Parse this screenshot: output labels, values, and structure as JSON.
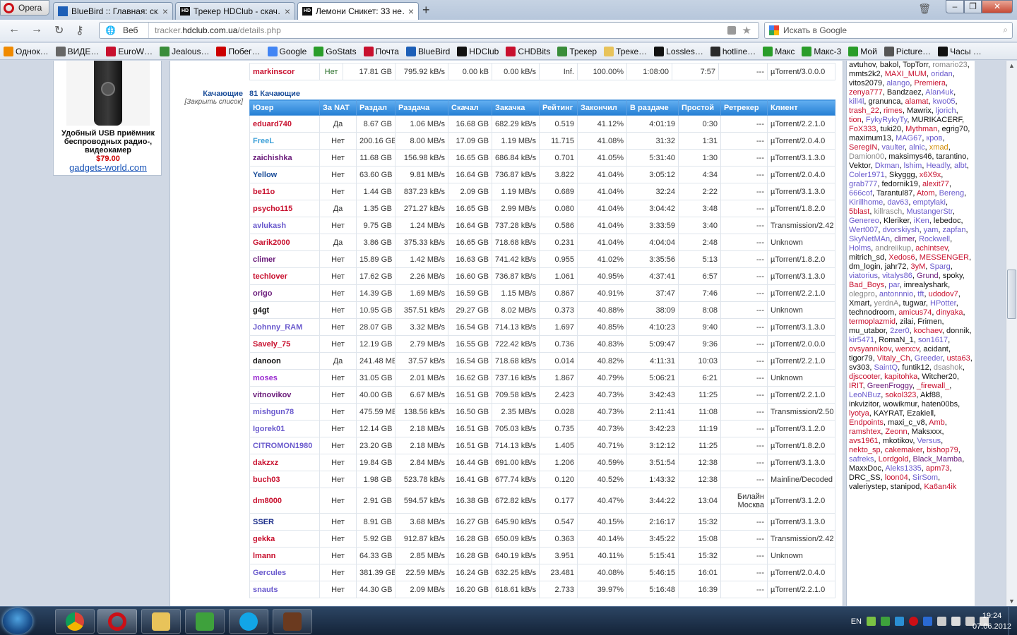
{
  "browser": {
    "menu_label": "Opera",
    "tabs": [
      {
        "title": "BlueBird :: Главная: ск…",
        "icon": "bluebird-favicon"
      },
      {
        "title": "Трекер HDClub - скач…",
        "icon": "hdclub-favicon"
      },
      {
        "title": "Лемони Сникет: 33 не…",
        "icon": "hdclub-favicon",
        "active": true
      }
    ],
    "new_tab": "+",
    "mode_label": "Веб",
    "url_prefix": "tracker.",
    "url_host": "hdclub.com.ua",
    "url_path": "/details.php",
    "search_placeholder": "Искать в Google",
    "bookmarks": [
      "Однок…",
      "ВИДЕ…",
      "EuroW…",
      "Jealous…",
      "Побег…",
      "Google",
      "GoStats",
      "Почта",
      "BlueBird",
      "HDClub",
      "CHDBits",
      "Трекер",
      "Треке…",
      "Lossles…",
      "hotline…",
      "Макс",
      "Макс-3",
      "Мой",
      "Picture…",
      "Часы …"
    ]
  },
  "ad": {
    "text": "Удобный USB приёмник беспроводных радио-, видеокамер",
    "price": "$79.00",
    "url": "gadgets-world.com"
  },
  "top_row": [
    "markinscor",
    "Нет",
    "17.81 GB",
    "795.92 kB/s",
    "0.00 kB",
    "0.00 kB/s",
    "Inf.",
    "100.00%",
    "1:08:00",
    "7:57",
    "---",
    "µTorrent/3.0.0.0"
  ],
  "section": {
    "title": "Качающие",
    "close_link": "[Закрыть список]",
    "count": "81 Качающие"
  },
  "headers": [
    "Юзер",
    "За NAT",
    "Раздал",
    "Раздача",
    "Скачал",
    "Закачка",
    "Рейтинг",
    "Закончил",
    "В раздаче",
    "Простой",
    "Ретрекер",
    "Клиент"
  ],
  "peers": [
    {
      "user": "eduard740",
      "color": "#c8102e",
      "nat": "Да",
      "up": "8.67 GB",
      "ups": "1.06 MB/s",
      "down": "16.68 GB",
      "downs": "682.29 kB/s",
      "ratio": "0.519",
      "done": "41.12%",
      "seed": "4:01:19",
      "idle": "0:30",
      "retr": "---",
      "client": "µTorrent/2.2.1.0"
    },
    {
      "user": "FreeL",
      "color": "#3da0d8",
      "nat": "Нет",
      "up": "200.16 GB",
      "ups": "8.00 MB/s",
      "down": "17.09 GB",
      "downs": "1.19 MB/s",
      "ratio": "11.715",
      "done": "41.08%",
      "seed": "31:32",
      "idle": "1:31",
      "retr": "---",
      "client": "µTorrent/2.0.4.0"
    },
    {
      "user": "zaichishka",
      "color": "#6a1b7a",
      "nat": "Нет",
      "up": "11.68 GB",
      "ups": "156.98 kB/s",
      "down": "16.65 GB",
      "downs": "686.84 kB/s",
      "ratio": "0.701",
      "done": "41.05%",
      "seed": "5:31:40",
      "idle": "1:30",
      "retr": "---",
      "client": "µTorrent/3.1.3.0"
    },
    {
      "user": "Yellow",
      "color": "#1d4f9a",
      "nat": "Нет",
      "up": "63.60 GB",
      "ups": "9.81 MB/s",
      "down": "16.64 GB",
      "downs": "736.87 kB/s",
      "ratio": "3.822",
      "done": "41.04%",
      "seed": "3:05:12",
      "idle": "4:34",
      "retr": "---",
      "client": "µTorrent/2.0.4.0"
    },
    {
      "user": "be11o",
      "color": "#c8102e",
      "nat": "Нет",
      "up": "1.44 GB",
      "ups": "837.23 kB/s",
      "down": "2.09 GB",
      "downs": "1.19 MB/s",
      "ratio": "0.689",
      "done": "41.04%",
      "seed": "32:24",
      "idle": "2:22",
      "retr": "---",
      "client": "µTorrent/3.1.3.0"
    },
    {
      "user": "psycho115",
      "color": "#c8102e",
      "nat": "Да",
      "up": "1.35 GB",
      "ups": "271.27 kB/s",
      "down": "16.65 GB",
      "downs": "2.99 MB/s",
      "ratio": "0.080",
      "done": "41.04%",
      "seed": "3:04:42",
      "idle": "3:48",
      "retr": "---",
      "client": "µTorrent/1.8.2.0"
    },
    {
      "user": "avlukash",
      "color": "#6a5acd",
      "nat": "Нет",
      "up": "9.75 GB",
      "ups": "1.24 MB/s",
      "down": "16.64 GB",
      "downs": "737.28 kB/s",
      "ratio": "0.586",
      "done": "41.04%",
      "seed": "3:33:59",
      "idle": "3:40",
      "retr": "---",
      "client": "Transmission/2.42"
    },
    {
      "user": "Garik2000",
      "color": "#c8102e",
      "nat": "Да",
      "up": "3.86 GB",
      "ups": "375.33 kB/s",
      "down": "16.65 GB",
      "downs": "718.68 kB/s",
      "ratio": "0.231",
      "done": "41.04%",
      "seed": "4:04:04",
      "idle": "2:48",
      "retr": "---",
      "client": "Unknown"
    },
    {
      "user": "climer",
      "color": "#6a1b7a",
      "nat": "Нет",
      "up": "15.89 GB",
      "ups": "1.42 MB/s",
      "down": "16.63 GB",
      "downs": "741.42 kB/s",
      "ratio": "0.955",
      "done": "41.02%",
      "seed": "3:35:56",
      "idle": "5:13",
      "retr": "---",
      "client": "µTorrent/1.8.2.0"
    },
    {
      "user": "techlover",
      "color": "#c8102e",
      "nat": "Нет",
      "up": "17.62 GB",
      "ups": "2.26 MB/s",
      "down": "16.60 GB",
      "downs": "736.87 kB/s",
      "ratio": "1.061",
      "done": "40.95%",
      "seed": "4:37:41",
      "idle": "6:57",
      "retr": "---",
      "client": "µTorrent/3.1.3.0"
    },
    {
      "user": "origo",
      "color": "#6a1b7a",
      "nat": "Нет",
      "up": "14.39 GB",
      "ups": "1.69 MB/s",
      "down": "16.59 GB",
      "downs": "1.15 MB/s",
      "ratio": "0.867",
      "done": "40.91%",
      "seed": "37:47",
      "idle": "7:46",
      "retr": "---",
      "client": "µTorrent/2.2.1.0"
    },
    {
      "user": "g4gt",
      "color": "#111111",
      "nat": "Нет",
      "up": "10.95 GB",
      "ups": "357.51 kB/s",
      "down": "29.27 GB",
      "downs": "8.02 MB/s",
      "ratio": "0.373",
      "done": "40.88%",
      "seed": "38:09",
      "idle": "8:08",
      "retr": "---",
      "client": "Unknown"
    },
    {
      "user": "Johnny_RAM",
      "color": "#6a5acd",
      "nat": "Нет",
      "up": "28.07 GB",
      "ups": "3.32 MB/s",
      "down": "16.54 GB",
      "downs": "714.13 kB/s",
      "ratio": "1.697",
      "done": "40.85%",
      "seed": "4:10:23",
      "idle": "9:40",
      "retr": "---",
      "client": "µTorrent/3.1.3.0"
    },
    {
      "user": "Savely_75",
      "color": "#c8102e",
      "nat": "Нет",
      "up": "12.19 GB",
      "ups": "2.79 MB/s",
      "down": "16.55 GB",
      "downs": "722.42 kB/s",
      "ratio": "0.736",
      "done": "40.83%",
      "seed": "5:09:47",
      "idle": "9:36",
      "retr": "---",
      "client": "µTorrent/2.0.0.0"
    },
    {
      "user": "danoon",
      "color": "#111111",
      "nat": "Да",
      "up": "241.48 MB",
      "ups": "37.57 kB/s",
      "down": "16.54 GB",
      "downs": "718.68 kB/s",
      "ratio": "0.014",
      "done": "40.82%",
      "seed": "4:11:31",
      "idle": "10:03",
      "retr": "---",
      "client": "µTorrent/2.2.1.0"
    },
    {
      "user": "moses",
      "color": "#9a2bd0",
      "nat": "Нет",
      "up": "31.05 GB",
      "ups": "2.01 MB/s",
      "down": "16.62 GB",
      "downs": "737.16 kB/s",
      "ratio": "1.867",
      "done": "40.79%",
      "seed": "5:06:21",
      "idle": "6:21",
      "retr": "---",
      "client": "Unknown"
    },
    {
      "user": "vitnovikov",
      "color": "#6a1b7a",
      "nat": "Нет",
      "up": "40.00 GB",
      "ups": "6.67 MB/s",
      "down": "16.51 GB",
      "downs": "709.58 kB/s",
      "ratio": "2.423",
      "done": "40.73%",
      "seed": "3:42:43",
      "idle": "11:25",
      "retr": "---",
      "client": "µTorrent/2.2.1.0"
    },
    {
      "user": "mishgun78",
      "color": "#6a5acd",
      "nat": "Нет",
      "up": "475.59 MB",
      "ups": "138.56 kB/s",
      "down": "16.50 GB",
      "downs": "2.35 MB/s",
      "ratio": "0.028",
      "done": "40.73%",
      "seed": "2:11:41",
      "idle": "11:08",
      "retr": "---",
      "client": "Transmission/2.50"
    },
    {
      "user": "Igorek01",
      "color": "#6a5acd",
      "nat": "Нет",
      "up": "12.14 GB",
      "ups": "2.18 MB/s",
      "down": "16.51 GB",
      "downs": "705.03 kB/s",
      "ratio": "0.735",
      "done": "40.73%",
      "seed": "3:42:23",
      "idle": "11:19",
      "retr": "---",
      "client": "µTorrent/3.1.2.0"
    },
    {
      "user": "CITROMON1980",
      "color": "#6a5acd",
      "nat": "Нет",
      "up": "23.20 GB",
      "ups": "2.18 MB/s",
      "down": "16.51 GB",
      "downs": "714.13 kB/s",
      "ratio": "1.405",
      "done": "40.71%",
      "seed": "3:12:12",
      "idle": "11:25",
      "retr": "---",
      "client": "µTorrent/1.8.2.0"
    },
    {
      "user": "dakzxz",
      "color": "#c8102e",
      "nat": "Нет",
      "up": "19.84 GB",
      "ups": "2.84 MB/s",
      "down": "16.44 GB",
      "downs": "691.00 kB/s",
      "ratio": "1.206",
      "done": "40.59%",
      "seed": "3:51:54",
      "idle": "12:38",
      "retr": "---",
      "client": "µTorrent/3.1.3.0"
    },
    {
      "user": "buch03",
      "color": "#c8102e",
      "nat": "Нет",
      "up": "1.98 GB",
      "ups": "523.78 kB/s",
      "down": "16.41 GB",
      "downs": "677.74 kB/s",
      "ratio": "0.120",
      "done": "40.52%",
      "seed": "1:43:32",
      "idle": "12:38",
      "retr": "---",
      "client": "Mainline/Decoded"
    },
    {
      "user": "dm8000",
      "color": "#c8102e",
      "nat": "Нет",
      "up": "2.91 GB",
      "ups": "594.57 kB/s",
      "down": "16.38 GB",
      "downs": "672.82 kB/s",
      "ratio": "0.177",
      "done": "40.47%",
      "seed": "3:44:22",
      "idle": "13:04",
      "retr": "Билайн Москва",
      "client": "µTorrent/3.1.2.0"
    },
    {
      "user": "SSER",
      "color": "#1d2f8a",
      "nat": "Нет",
      "up": "8.91 GB",
      "ups": "3.68 MB/s",
      "down": "16.27 GB",
      "downs": "645.90 kB/s",
      "ratio": "0.547",
      "done": "40.15%",
      "seed": "2:16:17",
      "idle": "15:32",
      "retr": "---",
      "client": "µTorrent/3.1.3.0"
    },
    {
      "user": "gekka",
      "color": "#c8102e",
      "nat": "Нет",
      "up": "5.92 GB",
      "ups": "912.87 kB/s",
      "down": "16.28 GB",
      "downs": "650.09 kB/s",
      "ratio": "0.363",
      "done": "40.14%",
      "seed": "3:45:22",
      "idle": "15:08",
      "retr": "---",
      "client": "Transmission/2.42"
    },
    {
      "user": "lmann",
      "color": "#c8102e",
      "nat": "Нет",
      "up": "64.33 GB",
      "ups": "2.85 MB/s",
      "down": "16.28 GB",
      "downs": "640.19 kB/s",
      "ratio": "3.951",
      "done": "40.11%",
      "seed": "5:15:41",
      "idle": "15:32",
      "retr": "---",
      "client": "Unknown"
    },
    {
      "user": "Gercules",
      "color": "#6a5acd",
      "nat": "Нет",
      "up": "381.39 GB",
      "ups": "22.59 MB/s",
      "down": "16.24 GB",
      "downs": "632.25 kB/s",
      "ratio": "23.481",
      "done": "40.08%",
      "seed": "5:46:15",
      "idle": "16:01",
      "retr": "---",
      "client": "µTorrent/2.0.4.0"
    },
    {
      "user": "snauts",
      "color": "#6a5acd",
      "nat": "Нет",
      "up": "44.30 GB",
      "ups": "2.09 MB/s",
      "down": "16.20 GB",
      "downs": "618.61 kB/s",
      "ratio": "2.733",
      "done": "39.97%",
      "seed": "5:16:48",
      "idle": "16:39",
      "retr": "---",
      "client": "µTorrent/2.2.1.0"
    }
  ],
  "online_users": [
    [
      "avtuhov",
      "#111"
    ],
    [
      "bakol",
      "#111"
    ],
    [
      "TopTorr",
      "#111"
    ],
    [
      "romario23",
      "#888"
    ],
    [
      "mmts2k2",
      "#111"
    ],
    [
      "MAXI_MUM",
      "#c8102e"
    ],
    [
      "oridan",
      "#6a5acd"
    ],
    [
      "vitos2079",
      "#111"
    ],
    [
      "alango",
      "#6a5acd"
    ],
    [
      "Premiera",
      "#c8102e"
    ],
    [
      "zenya777",
      "#c8102e"
    ],
    [
      "Bandzaez",
      "#111"
    ],
    [
      "Alan4uk",
      "#6a5acd"
    ],
    [
      "kill4l",
      "#6a5acd"
    ],
    [
      "granunca",
      "#111"
    ],
    [
      "alamat",
      "#c8102e"
    ],
    [
      "kwo05",
      "#6a5acd"
    ],
    [
      "trash_22",
      "#c8102e"
    ],
    [
      "rimes",
      "#c8102e"
    ],
    [
      "Mawrix",
      "#111"
    ],
    [
      "ljorich",
      "#6a5acd"
    ],
    [
      "tion",
      "#c8102e"
    ],
    [
      "FykyRykyTy",
      "#6a5acd"
    ],
    [
      "MURIKACERF",
      "#111"
    ],
    [
      "FoX333",
      "#c8102e"
    ],
    [
      "tuki20",
      "#111"
    ],
    [
      "Mythman",
      "#c8102e"
    ],
    [
      "egrig70",
      "#111"
    ],
    [
      "maximum13",
      "#111"
    ],
    [
      "MAG67",
      "#6a5acd"
    ],
    [
      "кров",
      "#6a5acd"
    ],
    [
      "SeregIN",
      "#c8102e"
    ],
    [
      "vaulter",
      "#6a5acd"
    ],
    [
      "alnic",
      "#6a5acd"
    ],
    [
      "xmad",
      "#d08a00"
    ],
    [
      "Damion00",
      "#888"
    ],
    [
      "maksimys46",
      "#111"
    ],
    [
      "tarantino",
      "#111"
    ],
    [
      "Vektor",
      "#111"
    ],
    [
      "Dkman",
      "#6a5acd"
    ],
    [
      "lshim",
      "#6a5acd"
    ],
    [
      "Headly",
      "#6a5acd"
    ],
    [
      "albt",
      "#6a5acd"
    ],
    [
      "Coler1971",
      "#6a5acd"
    ],
    [
      "Skyggg",
      "#111"
    ],
    [
      "x6X9x",
      "#c8102e"
    ],
    [
      "grab777",
      "#6a5acd"
    ],
    [
      "fedornik19",
      "#111"
    ],
    [
      "alexit77",
      "#c8102e"
    ],
    [
      "666cof",
      "#6a5acd"
    ],
    [
      "Tarantul87",
      "#111"
    ],
    [
      "Atom",
      "#c8102e"
    ],
    [
      "Bereng",
      "#6a5acd"
    ],
    [
      "Kirillhome",
      "#6a5acd"
    ],
    [
      "dav63",
      "#6a5acd"
    ],
    [
      "emptylaki",
      "#6a5acd"
    ],
    [
      "5blast",
      "#c8102e"
    ],
    [
      "killrasch",
      "#888"
    ],
    [
      "MustangerStr",
      "#6a5acd"
    ],
    [
      "Genereo",
      "#6a5acd"
    ],
    [
      "Kleriker",
      "#111"
    ],
    [
      "iKen",
      "#6a5acd"
    ],
    [
      "lebedoc",
      "#111"
    ],
    [
      "Wert007",
      "#6a5acd"
    ],
    [
      "dvorskiysh",
      "#6a5acd"
    ],
    [
      "yam",
      "#6a5acd"
    ],
    [
      "zapfan",
      "#6a5acd"
    ],
    [
      "SkyNetMAn",
      "#6a5acd"
    ],
    [
      "climer",
      "#6a1b7a"
    ],
    [
      "Rockwell",
      "#6a5acd"
    ],
    [
      "Holms",
      "#6a5acd"
    ],
    [
      "andreiikup",
      "#888"
    ],
    [
      "achintsev",
      "#c8102e"
    ],
    [
      "mitrich_sd",
      "#111"
    ],
    [
      "Xedos6",
      "#c8102e"
    ],
    [
      "MESSENGER",
      "#c8102e"
    ],
    [
      "dm_login",
      "#111"
    ],
    [
      "jahr72",
      "#111"
    ],
    [
      "3yM",
      "#c8102e"
    ],
    [
      "Sparg",
      "#6a5acd"
    ],
    [
      "viatorius",
      "#6a5acd"
    ],
    [
      "vitalys86",
      "#6a5acd"
    ],
    [
      "Grund",
      "#6a1b7a"
    ],
    [
      "spoky",
      "#111"
    ],
    [
      "Bad_Boys",
      "#c8102e"
    ],
    [
      "par",
      "#6a5acd"
    ],
    [
      "imrealyshark",
      "#111"
    ],
    [
      "olegpro",
      "#888"
    ],
    [
      "antonnnio",
      "#6a5acd"
    ],
    [
      "tft",
      "#6a5acd"
    ],
    [
      "udodov7",
      "#c8102e"
    ],
    [
      "Xmart",
      "#111"
    ],
    [
      "yerdnA",
      "#888"
    ],
    [
      "tugwar",
      "#111"
    ],
    [
      "HPotter",
      "#6a5acd"
    ],
    [
      "technodroom",
      "#111"
    ],
    [
      "amicus74",
      "#c8102e"
    ],
    [
      "dinyaka",
      "#c8102e"
    ],
    [
      "termoplazmid",
      "#c8102e"
    ],
    [
      "zilai",
      "#111"
    ],
    [
      "Frimen",
      "#111"
    ],
    [
      "mu_utabor",
      "#111"
    ],
    [
      "2zer0",
      "#6a5acd"
    ],
    [
      "kochaev",
      "#c8102e"
    ],
    [
      "donnik",
      "#111"
    ],
    [
      "kir5471",
      "#6a5acd"
    ],
    [
      "RomaN_1",
      "#111"
    ],
    [
      "son1617",
      "#6a5acd"
    ],
    [
      "ovsyannikov",
      "#c8102e"
    ],
    [
      "werxcv",
      "#c8102e"
    ],
    [
      "acidant",
      "#111"
    ],
    [
      "tigor79",
      "#111"
    ],
    [
      "Vitaly_Ch",
      "#c8102e"
    ],
    [
      "Greeder",
      "#6a5acd"
    ],
    [
      "usta63",
      "#c8102e"
    ],
    [
      "sv303",
      "#111"
    ],
    [
      "SaintQ",
      "#6a5acd"
    ],
    [
      "funtik12",
      "#111"
    ],
    [
      "dsashok",
      "#888"
    ],
    [
      "djscooter",
      "#c8102e"
    ],
    [
      "kapitohka",
      "#c8102e"
    ],
    [
      "Witcher20",
      "#111"
    ],
    [
      "IRIT",
      "#c8102e"
    ],
    [
      "GreenFroggy",
      "#6a1b7a"
    ],
    [
      "_firewall_",
      "#c8102e"
    ],
    [
      "LeoNBuz",
      "#6a5acd"
    ],
    [
      "sokol323",
      "#c8102e"
    ],
    [
      "Akf88",
      "#111"
    ],
    [
      "inkvizitor",
      "#111"
    ],
    [
      "wowikmur",
      "#111"
    ],
    [
      "haten00bs",
      "#111"
    ],
    [
      "lyotya",
      "#c8102e"
    ],
    [
      "KAYRAT",
      "#111"
    ],
    [
      "Ezakiell",
      "#111"
    ],
    [
      "Endpoints",
      "#c8102e"
    ],
    [
      "maxi_c_v8",
      "#111"
    ],
    [
      "Amb",
      "#c8102e"
    ],
    [
      "ramshtex",
      "#c8102e"
    ],
    [
      "Zeonn",
      "#c8102e"
    ],
    [
      "Maksxxx",
      "#111"
    ],
    [
      "avs1961",
      "#c8102e"
    ],
    [
      "mkotikov",
      "#111"
    ],
    [
      "Versus",
      "#6a5acd"
    ],
    [
      "nekto_sp",
      "#c8102e"
    ],
    [
      "cakemaker",
      "#c8102e"
    ],
    [
      "bishop79",
      "#c8102e"
    ],
    [
      "safreks",
      "#6a5acd"
    ],
    [
      "Lordgold",
      "#c8102e"
    ],
    [
      "Black_Mamba",
      "#6a1b7a"
    ],
    [
      "MaxxDoc",
      "#111"
    ],
    [
      "Aleks1335",
      "#6a5acd"
    ],
    [
      "apm73",
      "#c8102e"
    ],
    [
      "DRC_SS",
      "#111"
    ],
    [
      "loon04",
      "#c8102e"
    ],
    [
      "SirSom",
      "#6a5acd"
    ],
    [
      "valeriystep",
      "#111"
    ],
    [
      "stanipod",
      "#111"
    ],
    [
      "Ka6an4ik",
      "#c8102e"
    ]
  ],
  "taskbar": {
    "lang": "EN",
    "time": "19:24",
    "date": "07.06.2012"
  }
}
